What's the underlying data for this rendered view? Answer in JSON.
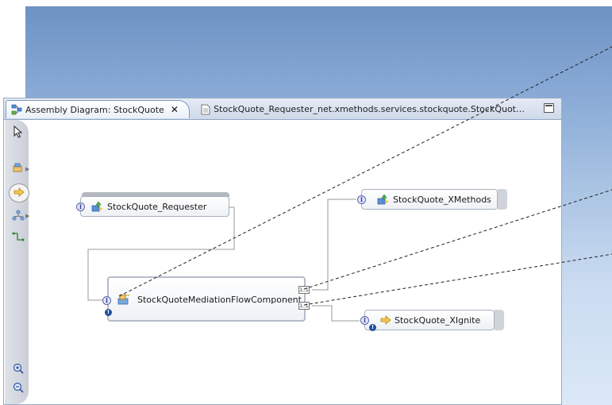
{
  "editor": {
    "active_tab": {
      "title": "Assembly Diagram: StockQuote",
      "icon": "assembly-diagram-icon",
      "close_glyph": "✕"
    },
    "other_tab": {
      "title": "StockQuote_Requester_net.xmethods.services.stockquote.StockQuot…",
      "icon": "document-icon"
    }
  },
  "palette": {
    "items": [
      {
        "name": "selection-tool-icon"
      },
      {
        "name": "component-drawer-icon"
      },
      {
        "name": "import-export-drawer-icon"
      },
      {
        "name": "composite-drawer-icon"
      },
      {
        "name": "wire-tool-icon"
      },
      {
        "name": "zoom-in-icon"
      },
      {
        "name": "zoom-out-icon"
      }
    ]
  },
  "diagram": {
    "requester": "StockQuote_Requester",
    "mediation": "StockQuoteMediationFlowComponent",
    "xmethods": "StockQuote_XMethods",
    "xignite": "StockQuote_XIgnite",
    "ref_label_1": "1..1",
    "ref_label_2": "1..1",
    "interface_glyph": "I",
    "warning_glyph": "!"
  },
  "colors": {
    "background_top": "#6d92c3",
    "background_bottom": "#dbe8f7",
    "interface_blue": "#5a63a8",
    "badge_blue": "#1f4f9e"
  }
}
